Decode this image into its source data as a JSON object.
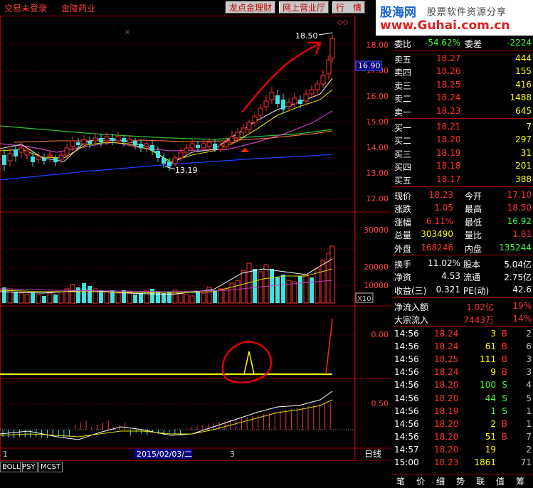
{
  "toolbar": {
    "login_status": "交易未登录",
    "stock_name": "金陵药业",
    "btn_longdian": "龙点金理财",
    "btn_wangshang": "网上营业厅",
    "btn_hangqing": "行　情"
  },
  "logo": {
    "brand": "股海网",
    "tagline": "股票软件资源分享",
    "url": "www.Guhai.com.cn"
  },
  "chart": {
    "price_axis": [
      "18.00",
      "17.00",
      "16.00",
      "15.00",
      "14.00",
      "13.00",
      "12.00"
    ],
    "current_price_tag": "16.90",
    "high_label": "18.50",
    "low_label": "13.19",
    "vol_axis": [
      "30000",
      "20000",
      "10000"
    ],
    "vol_unit": "X10",
    "ind1_axis": [
      "0.00"
    ],
    "ind2_axis": [
      "0.50"
    ],
    "date_marker": "2015/02/03/二",
    "x_tick_left": "1",
    "x_tick_mid": "3",
    "period": "日线",
    "zoom_minus": "-",
    "zoom_plus": "+"
  },
  "indicators": [
    "BOLL",
    "PSY",
    "MCST"
  ],
  "quote": {
    "weibi_label": "委比",
    "weibi": "-54.62%",
    "weicha_label": "委差",
    "weicha": "-2224",
    "asks": [
      {
        "label": "卖五",
        "price": "18.27",
        "vol": "444"
      },
      {
        "label": "卖四",
        "price": "18.26",
        "vol": "155"
      },
      {
        "label": "卖三",
        "price": "18.25",
        "vol": "416"
      },
      {
        "label": "卖二",
        "price": "18.24",
        "vol": "1488"
      },
      {
        "label": "卖一",
        "price": "18.23",
        "vol": "645"
      }
    ],
    "bids": [
      {
        "label": "买一",
        "price": "18.21",
        "vol": "7"
      },
      {
        "label": "买二",
        "price": "18.20",
        "vol": "297"
      },
      {
        "label": "买三",
        "price": "18.19",
        "vol": "31"
      },
      {
        "label": "买四",
        "price": "18.18",
        "vol": "201"
      },
      {
        "label": "买五",
        "price": "18.17",
        "vol": "388"
      }
    ],
    "stats": [
      {
        "l1": "现价",
        "v1": "18.23",
        "l2": "今开",
        "v2": "17.10"
      },
      {
        "l1": "涨跌",
        "v1": "1.05",
        "l2": "最高",
        "v2": "18.50"
      },
      {
        "l1": "涨幅",
        "v1": "6.11%",
        "l2": "最低",
        "v2": "16.92"
      },
      {
        "l1": "总量",
        "v1": "303490",
        "l2": "量比",
        "v2": "1.81"
      },
      {
        "l1": "外盘",
        "v1": "168246",
        "l2": "内盘",
        "v2": "135244"
      }
    ],
    "fund": [
      {
        "l1": "换手",
        "v1": "11.02%",
        "l2": "股本",
        "v2": "5.04亿"
      },
      {
        "l1": "净资",
        "v1": "4.53",
        "l2": "流通",
        "v2": "2.75亿"
      },
      {
        "l1": "收益(三)",
        "v1": "0.321",
        "l2": "PE(动)",
        "v2": "42.6"
      }
    ],
    "flow": [
      {
        "label": "净流入额",
        "value": "1.02亿",
        "pct": "19%"
      },
      {
        "label": "大宗流入",
        "value": "7443万",
        "pct": "14%"
      }
    ]
  },
  "ticks": [
    {
      "time": "14:56",
      "price": "18.24",
      "vol": "3",
      "side": "B",
      "n": "2"
    },
    {
      "time": "14:56",
      "price": "18.24",
      "vol": "61",
      "side": "B",
      "n": "6"
    },
    {
      "time": "14:56",
      "price": "18.25",
      "vol": "111",
      "side": "B",
      "n": "3"
    },
    {
      "time": "14:56",
      "price": "18.24",
      "vol": "9",
      "side": "B",
      "n": "3"
    },
    {
      "time": "14:56",
      "price": "18.20",
      "vol": "100",
      "side": "S",
      "n": "4"
    },
    {
      "time": "14:56",
      "price": "18.20",
      "vol": "44",
      "side": "S",
      "n": "5"
    },
    {
      "time": "14:56",
      "price": "18.19",
      "vol": "1",
      "side": "S",
      "n": "1"
    },
    {
      "time": "14:56",
      "price": "18.20",
      "vol": "2",
      "side": "B",
      "n": "1"
    },
    {
      "time": "14:56",
      "price": "18.20",
      "vol": "51",
      "side": "B",
      "n": "7"
    },
    {
      "time": "14:57",
      "price": "18.20",
      "vol": "19",
      "side": "",
      "n": "2"
    },
    {
      "time": "15:00",
      "price": "18.23",
      "vol": "1861",
      "side": "",
      "n": "71"
    }
  ],
  "right_tabs": [
    "笔",
    "价",
    "细",
    "势",
    "联",
    "值",
    "筹"
  ],
  "colors": {
    "up": "#ff3030",
    "down": "#40e0e0",
    "even": "#c0c0c0",
    "yellow": "#ffff00",
    "border": "#a00000"
  }
}
